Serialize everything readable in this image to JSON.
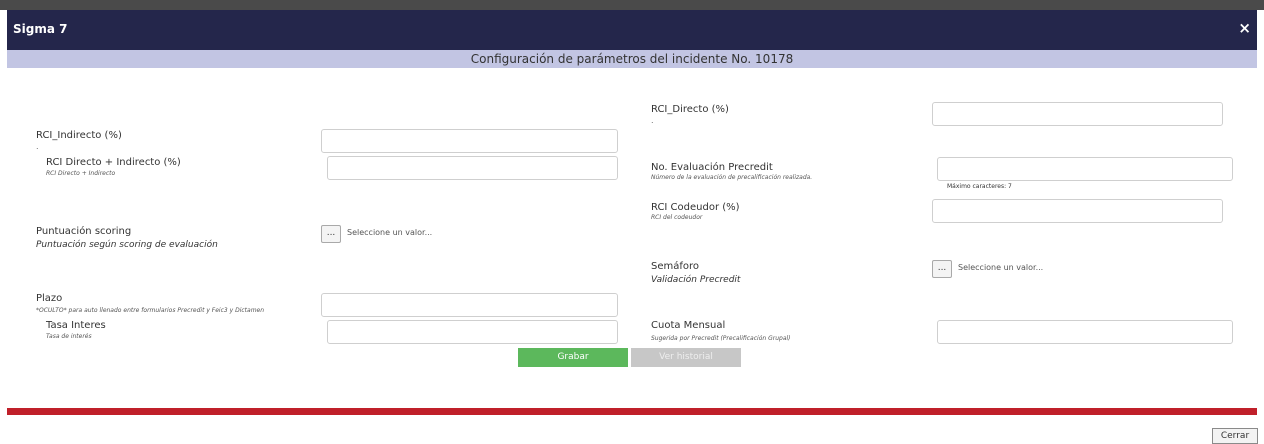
{
  "window": {
    "title": "Sigma 7",
    "close_icon": "×"
  },
  "header": {
    "subtitle": "Configuración de parámetros del incidente No. 10178"
  },
  "left": {
    "rci_indirecto": {
      "label": "RCI_Indirecto (%)",
      "sub": "."
    },
    "rci_directo_indirecto": {
      "label": "RCI Directo + Indirecto (%)",
      "sub": "RCI Directo + Indirecto"
    },
    "puntuacion": {
      "label": "Puntuación scoring",
      "sub": "Puntuación según scoring de evaluación",
      "placeholder": "Seleccione un valor..."
    },
    "plazo": {
      "label": "Plazo",
      "sub": "*OCULTO* para auto llenado entre formularios Precredit y Feic3 y Dictamen"
    },
    "tasa": {
      "label": "Tasa Interes",
      "sub": "Tasa de interés"
    }
  },
  "right": {
    "rci_directo": {
      "label": "RCI_Directo (%)",
      "sub": "."
    },
    "evaluacion": {
      "label": "No. Evaluación Precredit",
      "sub": "Número de la evaluación de precalificación realizada.",
      "hint": "Máximo caracteres: 7"
    },
    "codeudor": {
      "label": "RCI Codeudor (%)",
      "sub": "RCI del codeudor"
    },
    "semaforo": {
      "label": "Semáforo",
      "sub": "Validación Precredit",
      "placeholder": "Seleccione un valor..."
    },
    "cuota": {
      "label": "Cuota Mensual",
      "sub": "Sugerida por Precredit (Precalificación Grupal)"
    }
  },
  "actions": {
    "grabar": "Grabar",
    "historial": "Ver historial"
  },
  "footer": {
    "cerrar": "Cerrar"
  },
  "colors": {
    "titlebar": "#24264b",
    "subheader": "#c2c5e3",
    "red_bar": "#c0202a",
    "save": "#5cb85c",
    "disabled": "#c7c7c7"
  }
}
